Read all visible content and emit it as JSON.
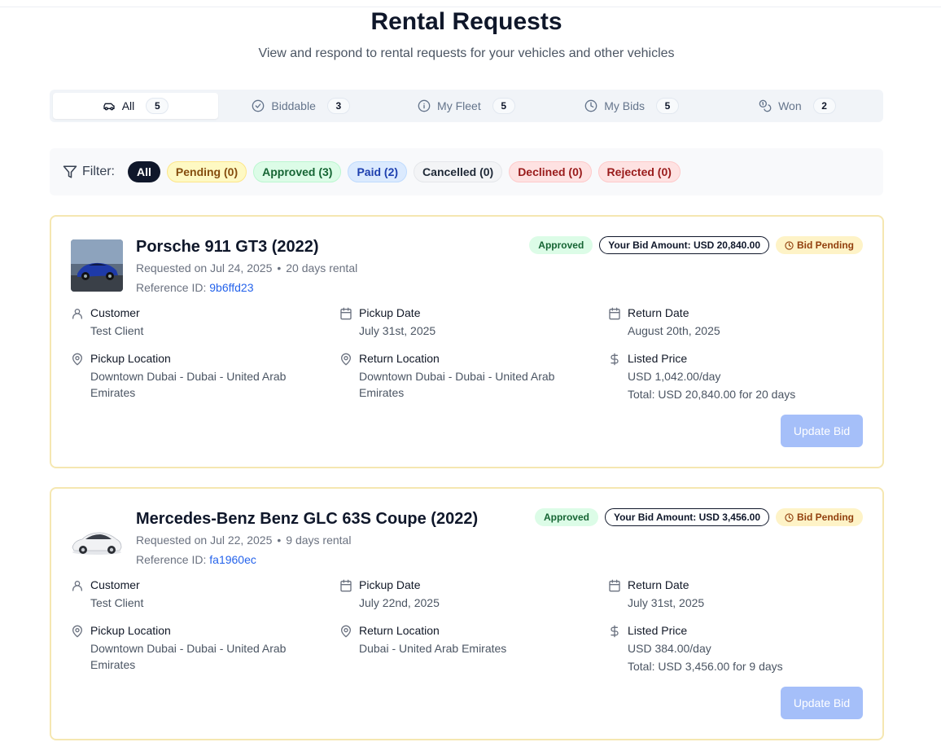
{
  "page": {
    "title": "Rental Requests",
    "subtitle": "View and respond to rental requests for your vehicles and other vehicles"
  },
  "tabs": [
    {
      "label": "All",
      "count": "5",
      "icon": "car-icon"
    },
    {
      "label": "Biddable",
      "count": "3",
      "icon": "check-circle-icon"
    },
    {
      "label": "My Fleet",
      "count": "5",
      "icon": "info-icon"
    },
    {
      "label": "My Bids",
      "count": "5",
      "icon": "clock-icon"
    },
    {
      "label": "Won",
      "count": "2",
      "icon": "coins-icon"
    }
  ],
  "filter": {
    "label": "Filter:",
    "chips": [
      {
        "label": "All"
      },
      {
        "label": "Pending (0)"
      },
      {
        "label": "Approved (3)"
      },
      {
        "label": "Paid (2)"
      },
      {
        "label": "Cancelled (0)"
      },
      {
        "label": "Declined (0)"
      },
      {
        "label": "Rejected (0)"
      }
    ]
  },
  "requests": [
    {
      "title": "Porsche 911 GT3 (2022)",
      "requested": "Requested on Jul 24, 2025",
      "duration": "20 days rental",
      "ref_label": "Reference ID:",
      "ref_id": "9b6ffd23",
      "status": "Approved",
      "bid": "Your Bid Amount: USD 20,840.00",
      "bid_status": "Bid Pending",
      "customer_label": "Customer",
      "customer": "Test Client",
      "pickup_date_label": "Pickup Date",
      "pickup_date": "July 31st, 2025",
      "return_date_label": "Return Date",
      "return_date": "August 20th, 2025",
      "pickup_location_label": "Pickup Location",
      "pickup_location": "Downtown Dubai - Dubai - United Arab Emirates",
      "return_location_label": "Return Location",
      "return_location": "Downtown Dubai - Dubai - United Arab Emirates",
      "price_label": "Listed Price",
      "price": "USD 1,042.00/day",
      "total": "Total: USD 20,840.00 for 20 days",
      "button": "Update Bid"
    },
    {
      "title": "Mercedes-Benz Benz GLC 63S Coupe (2022)",
      "requested": "Requested on Jul 22, 2025",
      "duration": "9 days rental",
      "ref_label": "Reference ID:",
      "ref_id": "fa1960ec",
      "status": "Approved",
      "bid": "Your Bid Amount: USD 3,456.00",
      "bid_status": "Bid Pending",
      "customer_label": "Customer",
      "customer": "Test Client",
      "pickup_date_label": "Pickup Date",
      "pickup_date": "July 22nd, 2025",
      "return_date_label": "Return Date",
      "return_date": "July 31st, 2025",
      "pickup_location_label": "Pickup Location",
      "pickup_location": "Downtown Dubai - Dubai - United Arab Emirates",
      "return_location_label": "Return Location",
      "return_location": "Dubai - United Arab Emirates",
      "price_label": "Listed Price",
      "price": "USD 384.00/day",
      "total": "Total: USD 3,456.00 for 9 days",
      "button": "Update Bid"
    }
  ]
}
